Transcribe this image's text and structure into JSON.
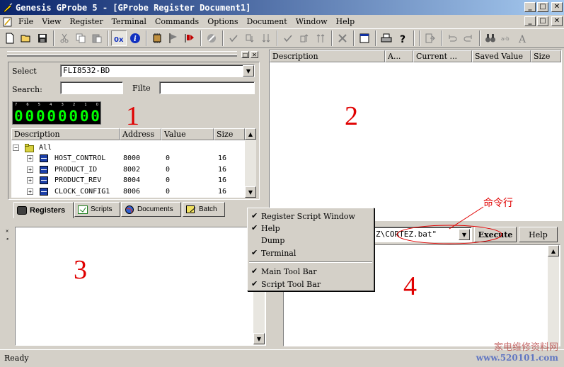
{
  "window": {
    "title": "Genesis GProbe 5 - [GProbe Register Document1]",
    "btn_min": "_",
    "btn_max": "□",
    "btn_close": "✕"
  },
  "menu": [
    "File",
    "View",
    "Register",
    "Terminal",
    "Commands",
    "Options",
    "Document",
    "Window",
    "Help"
  ],
  "register_panel": {
    "select_label": "Select",
    "select_value": "FLI8532-BD",
    "search_label": "Search:",
    "filter_label": "Filte",
    "led_bits": [
      "7",
      "6",
      "5",
      "4",
      "3",
      "2",
      "1",
      "0"
    ],
    "led_digits": [
      "0",
      "0",
      "0",
      "0",
      "0",
      "0",
      "0",
      "0"
    ],
    "columns": [
      "Description",
      "Address",
      "Value",
      "Size"
    ],
    "root": "All",
    "rows": [
      {
        "name": "HOST_CONTROL",
        "address": "8000",
        "value": "0",
        "size": "16"
      },
      {
        "name": "PRODUCT_ID",
        "address": "8002",
        "value": "0",
        "size": "16"
      },
      {
        "name": "PRODUCT_REV",
        "address": "8004",
        "value": "0",
        "size": "16"
      },
      {
        "name": "CLOCK_CONFIG1",
        "address": "8006",
        "value": "0",
        "size": "16"
      }
    ]
  },
  "tabs": [
    "Registers",
    "Scripts",
    "Documents",
    "Batch"
  ],
  "right_panel": {
    "columns": [
      "Description",
      "A...",
      "Current ...",
      "Saved Value",
      "Size"
    ]
  },
  "context_menu": {
    "items": [
      {
        "label": "Register Script Window",
        "checked": "✔"
      },
      {
        "label": "Help",
        "checked": "✔"
      },
      {
        "label": "Dump",
        "checked": ""
      },
      {
        "label": "Terminal",
        "checked": "✔"
      },
      {
        "label": "Main Tool Bar",
        "checked": "✔"
      },
      {
        "label": "Script Tool Bar",
        "checked": "✔"
      }
    ]
  },
  "command_bar": {
    "value": "Z\\CORTEZ.bat\"",
    "execute": "Execute",
    "help": "Help"
  },
  "annotations": {
    "n1": "1",
    "n2": "2",
    "n3": "3",
    "n4": "4",
    "cmd_line": "命令行",
    "annotation_color": "#e00000"
  },
  "status": "Ready",
  "watermark": {
    "line1": "家电维修资料网",
    "line2": "www.520101.com"
  }
}
